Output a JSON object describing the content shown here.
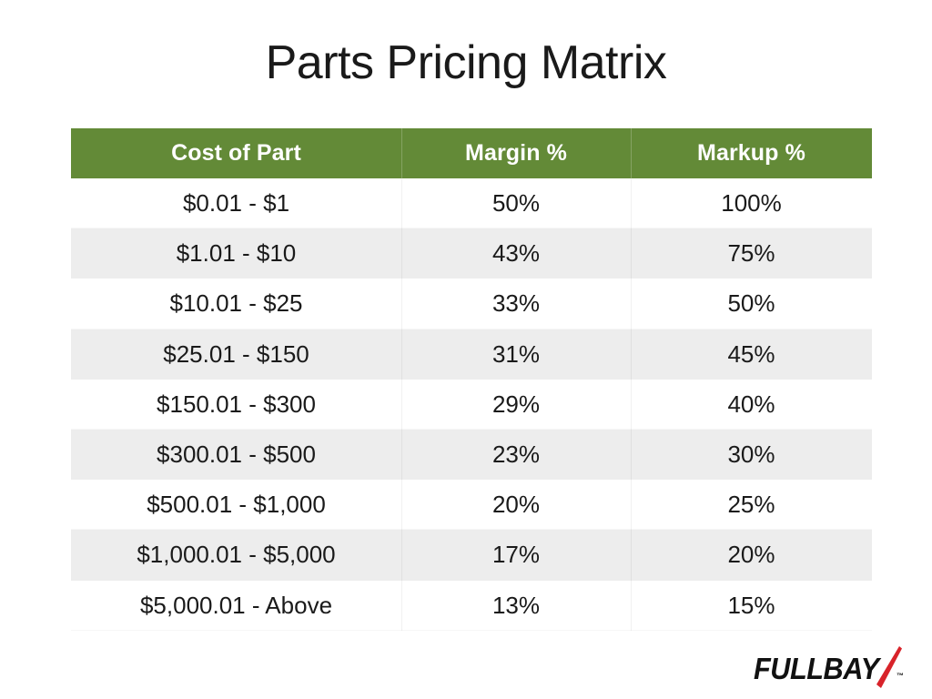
{
  "slide": {
    "title": "Parts Pricing Matrix",
    "background_color": "#ffffff"
  },
  "table": {
    "header_background": "#638a37",
    "header_text_color": "#ffffff",
    "stripe_color": "#ededed",
    "columns": [
      {
        "key": "cost_of_part",
        "label": "Cost of Part"
      },
      {
        "key": "margin_pct",
        "label": "Margin %"
      },
      {
        "key": "markup_pct",
        "label": "Markup %"
      }
    ],
    "rows": [
      {
        "cost_of_part": "$0.01 - $1",
        "margin_pct": "50%",
        "markup_pct": "100%"
      },
      {
        "cost_of_part": "$1.01 - $10",
        "margin_pct": "43%",
        "markup_pct": "75%"
      },
      {
        "cost_of_part": "$10.01 - $25",
        "margin_pct": "33%",
        "markup_pct": "50%"
      },
      {
        "cost_of_part": "$25.01 - $150",
        "margin_pct": "31%",
        "markup_pct": "45%"
      },
      {
        "cost_of_part": "$150.01 - $300",
        "margin_pct": "29%",
        "markup_pct": "40%"
      },
      {
        "cost_of_part": "$300.01 - $500",
        "margin_pct": "23%",
        "markup_pct": "30%"
      },
      {
        "cost_of_part": "$500.01 - $1,000",
        "margin_pct": "20%",
        "markup_pct": "25%"
      },
      {
        "cost_of_part": "$1,000.01 - $5,000",
        "margin_pct": "17%",
        "markup_pct": "20%"
      },
      {
        "cost_of_part": "$5,000.01 - Above",
        "margin_pct": "13%",
        "markup_pct": "15%"
      }
    ]
  },
  "logo": {
    "wordmark": "FULLBAY",
    "trademark": "™",
    "slash_color": "#d8232a",
    "text_color": "#111111"
  },
  "chart_data": {
    "type": "table",
    "title": "Parts Pricing Matrix",
    "columns": [
      "Cost of Part",
      "Margin %",
      "Markup %"
    ],
    "rows": [
      [
        "$0.01 - $1",
        "50%",
        "100%"
      ],
      [
        "$1.01 - $10",
        "43%",
        "75%"
      ],
      [
        "$10.01 - $25",
        "33%",
        "50%"
      ],
      [
        "$25.01 - $150",
        "31%",
        "45%"
      ],
      [
        "$150.01 - $300",
        "29%",
        "40%"
      ],
      [
        "$300.01 - $500",
        "23%",
        "30%"
      ],
      [
        "$500.01 - $1,000",
        "20%",
        "25%"
      ],
      [
        "$1,000.01 - $5,000",
        "17%",
        "20%"
      ],
      [
        "$5,000.01 - Above",
        "13%",
        "15%"
      ]
    ],
    "margin_values": [
      50,
      43,
      33,
      31,
      29,
      23,
      20,
      17,
      13
    ],
    "markup_values": [
      100,
      75,
      50,
      45,
      40,
      30,
      25,
      20,
      15
    ]
  }
}
